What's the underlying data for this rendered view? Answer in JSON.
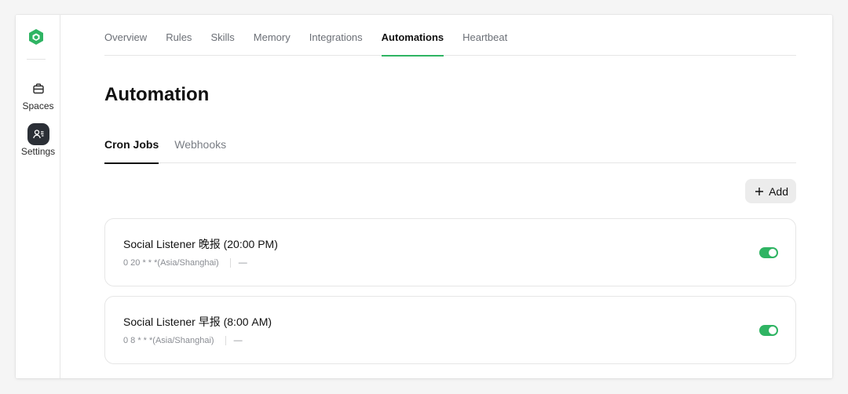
{
  "sidebar": {
    "items": [
      {
        "label": "Spaces",
        "icon": "briefcase-icon"
      },
      {
        "label": "Settings",
        "icon": "user-settings-icon"
      }
    ]
  },
  "top_tabs": [
    {
      "label": "Overview"
    },
    {
      "label": "Rules"
    },
    {
      "label": "Skills"
    },
    {
      "label": "Memory"
    },
    {
      "label": "Integrations"
    },
    {
      "label": "Automations",
      "active": true
    },
    {
      "label": "Heartbeat"
    }
  ],
  "page": {
    "title": "Automation"
  },
  "sub_tabs": [
    {
      "label": "Cron Jobs",
      "active": true
    },
    {
      "label": "Webhooks"
    }
  ],
  "add_button": {
    "label": "Add",
    "icon": "plus-icon"
  },
  "jobs": [
    {
      "title": "Social Listener 晚报 (20:00 PM)",
      "schedule": "0 20 * * *(Asia/Shanghai)",
      "extra": "—",
      "enabled": true
    },
    {
      "title": "Social Listener 早报 (8:00 AM)",
      "schedule": "0 8 * * *(Asia/Shanghai)",
      "extra": "—",
      "enabled": true
    }
  ],
  "colors": {
    "accent": "#2fb463",
    "active_icon_bg": "#2b2f36",
    "logo": "#2fb463"
  }
}
